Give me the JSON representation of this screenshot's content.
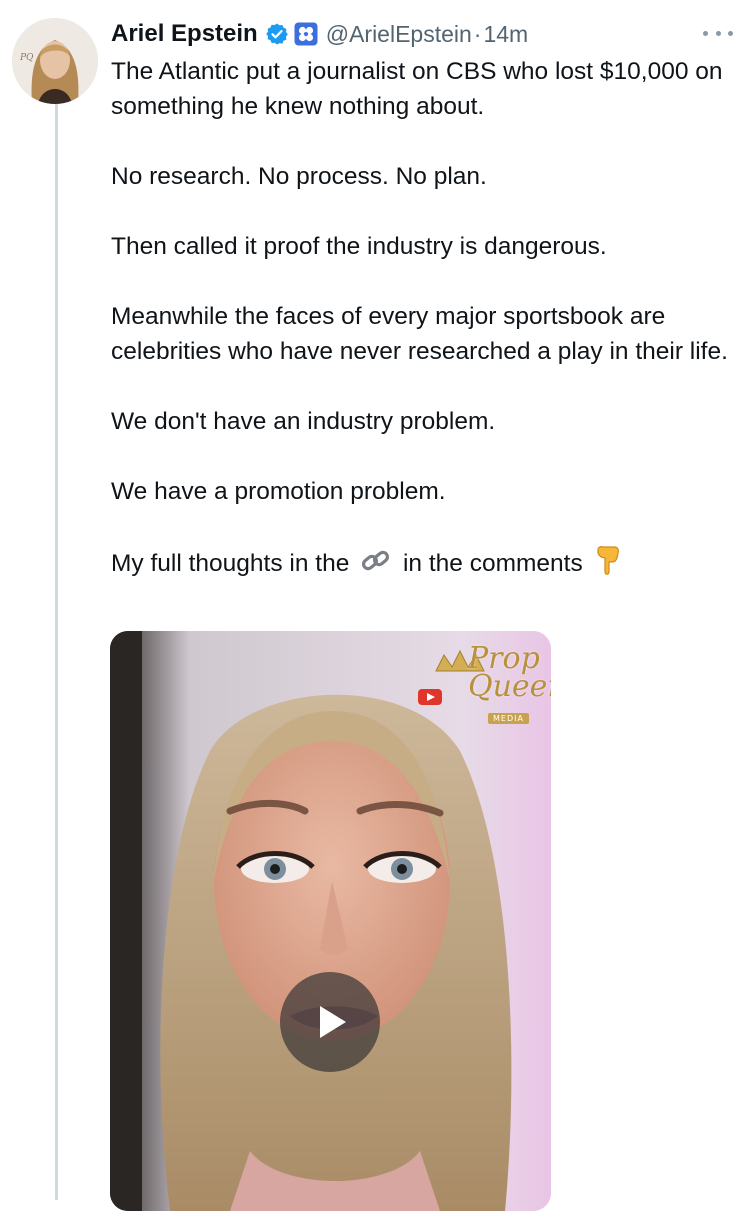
{
  "tweet": {
    "author_name": "Ariel Epstein",
    "handle": "@ArielEpstein",
    "separator": "·",
    "time": "14m",
    "paragraphs": [
      "The Atlantic put a journalist on CBS who lost $10,000 on something he knew nothing about.",
      "No research. No process. No plan.",
      "Then called it proof the industry is dangerous.",
      "Meanwhile the faces of every major sportsbook are celebrities who have never researched a play in their life.",
      "We don't have an industry problem.",
      "We have a promotion problem."
    ],
    "last_line": {
      "before": "My full thoughts in the",
      "emoji_link": "🔗",
      "after": "in the comments",
      "emoji_point": "👇"
    }
  },
  "avatar": {
    "monogram": "PQ",
    "icon": "avatar-photo"
  },
  "icons": {
    "verified": "verified-badge-icon",
    "affiliate": "affiliate-badge-icon",
    "more": "more-options-icon",
    "play": "play-icon"
  },
  "media": {
    "watermark_title": "Prop Queen",
    "watermark_subtitle": "MEDIA"
  },
  "colors": {
    "text": "#0f1419",
    "secondary": "#536471",
    "verified_blue": "#1d9bf0",
    "thread_line": "#cfd9de"
  }
}
